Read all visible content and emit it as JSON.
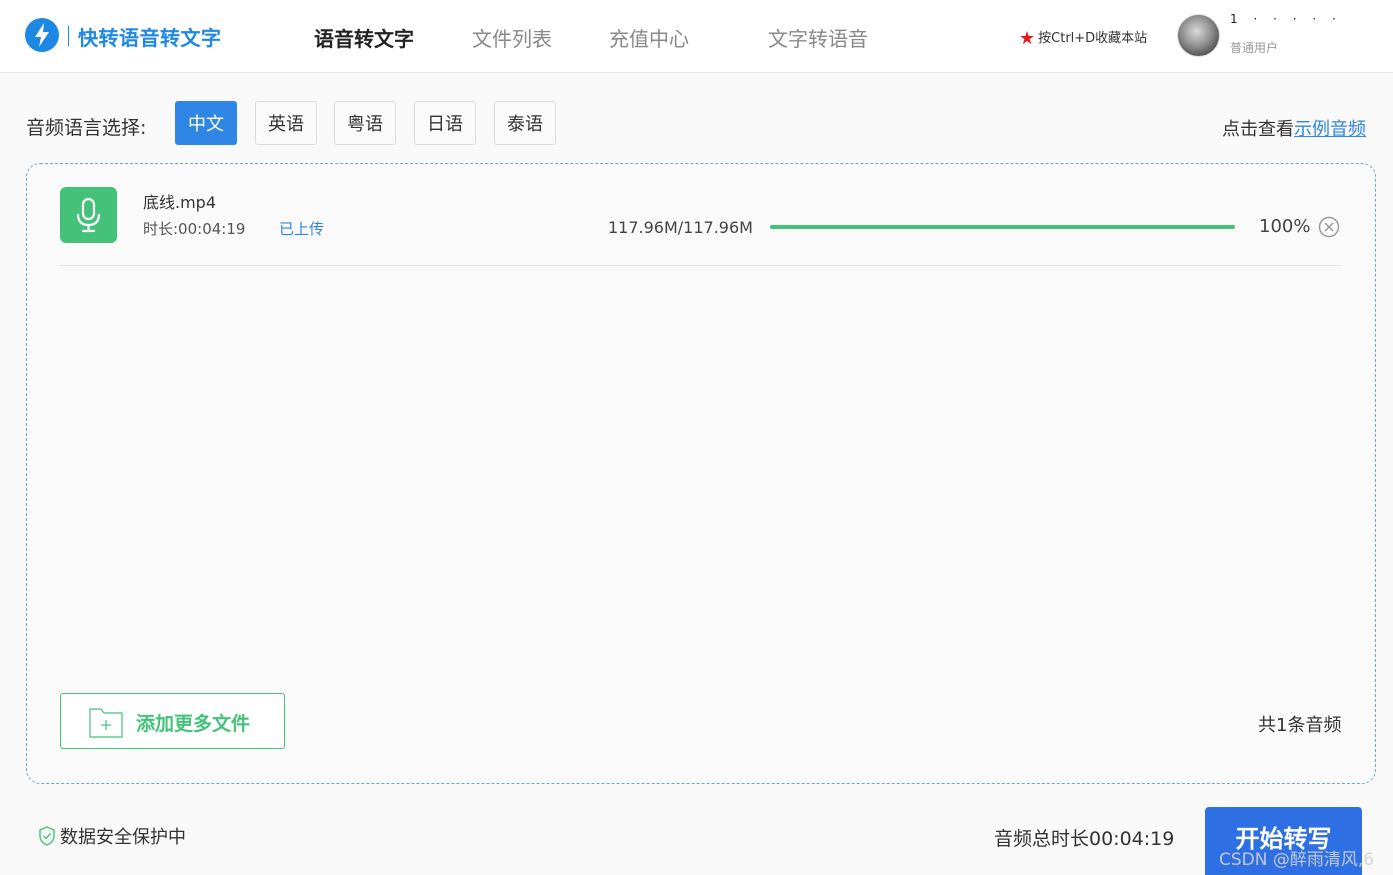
{
  "header": {
    "app_title": "快转语音转文字",
    "nav": [
      {
        "label": "语音转文字",
        "active": true
      },
      {
        "label": "文件列表",
        "active": false
      },
      {
        "label": "充值中心",
        "active": false
      },
      {
        "label": "文字转语音",
        "active": false
      }
    ],
    "bookmark_hint": "按Ctrl+D收藏本站",
    "user": {
      "name": "1 · · · · ·",
      "role": "普通用户"
    }
  },
  "language": {
    "label": "音频语言选择:",
    "options": [
      "中文",
      "英语",
      "粤语",
      "日语",
      "泰语"
    ],
    "selected": "中文",
    "sample_prefix": "点击查看",
    "sample_link": "示例音频"
  },
  "file": {
    "name": "底线.mp4",
    "duration": "时长:00:04:19",
    "status": "已上传",
    "size": "117.96M/117.96M",
    "progress": 1.0,
    "percent": "100%"
  },
  "actions": {
    "add_more": "添加更多文件",
    "count": "共1条音频"
  },
  "footer": {
    "secure": "数据安全保护中",
    "total": "音频总时长00:04:19",
    "start": "开始转写",
    "watermark": "CSDN @醉雨清风,6"
  },
  "colors": {
    "brand_blue": "#1e88e5",
    "accent_blue": "#2f86e4",
    "green": "#45c27a",
    "button_blue": "#2f6fe4"
  }
}
